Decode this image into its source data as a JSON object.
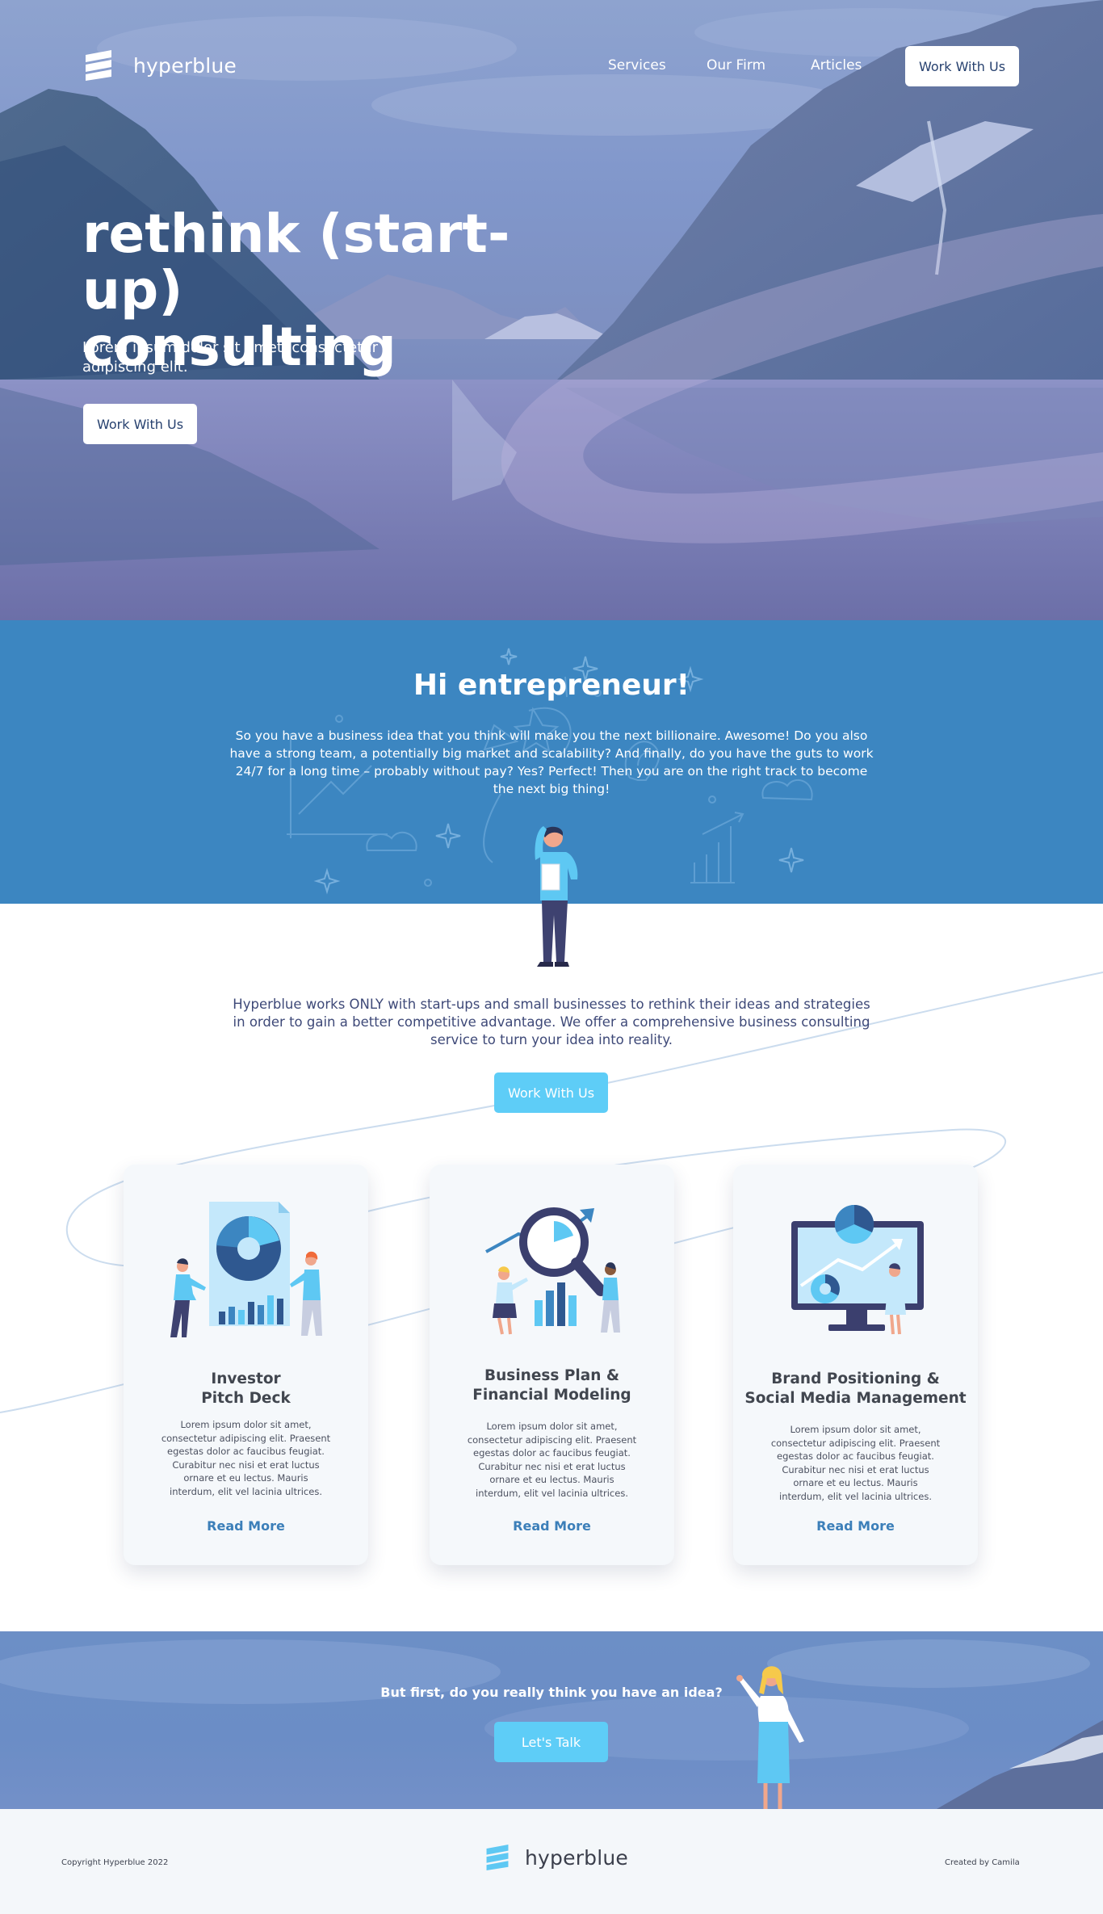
{
  "nav": {
    "brand": "hyperblue",
    "links": [
      "Services",
      "Our Firm",
      "Articles"
    ],
    "cta": "Work With Us"
  },
  "hero": {
    "title_line1": "rethink (start-up)",
    "title_line2": "consulting",
    "subtitle": "Lorem ipsum dolor sit amet, consectetur adipiscing elit.",
    "cta": "Work With Us"
  },
  "intro": {
    "title": "Hi entrepreneur!",
    "text": "So you have a business idea that you think will make you the next billionaire. Awesome! Do you also have a strong team, a potentially big market and scalability? And finally, do you have the guts to work 24/7 for a long time – probably without pay? Yes? Perfect! Then you are on the right track to become the next big thing!"
  },
  "about": {
    "text": "Hyperblue works ONLY with start-ups and small businesses to rethink their ideas and strategies in order to gain a better competitive advantage. We offer a comprehensive business consulting service to turn your idea into reality.",
    "cta": "Work With Us"
  },
  "services": [
    {
      "title_line1": "Investor",
      "title_line2": "Pitch Deck",
      "description": "Lorem ipsum dolor sit amet, consectetur adipiscing elit. Praesent egestas dolor ac faucibus feugiat. Curabitur nec nisi et erat luctus ornare et eu lectus. Mauris interdum, elit vel lacinia ultrices.",
      "link": "Read More"
    },
    {
      "title_line1": "Business Plan &",
      "title_line2": "Financial Modeling",
      "description": "Lorem ipsum dolor sit amet, consectetur adipiscing elit. Praesent egestas dolor ac faucibus feugiat. Curabitur nec nisi et erat luctus ornare et eu lectus. Mauris interdum, elit vel lacinia ultrices.",
      "link": "Read More"
    },
    {
      "title_line1": "Brand Positioning &",
      "title_line2": "Social Media Management",
      "description": "Lorem ipsum dolor sit amet, consectetur adipiscing elit. Praesent egestas dolor ac faucibus feugiat. Curabitur nec nisi et erat luctus ornare et eu lectus. Mauris interdum, elit vel lacinia ultrices.",
      "link": "Read More"
    }
  ],
  "cta_band": {
    "question": "But first, do you really think you have an idea?",
    "button": "Let's Talk"
  },
  "footer": {
    "copyright": "Copyright Hyperblue 2022",
    "brand": "hyperblue",
    "credit": "Created by Camila"
  },
  "colors": {
    "brand_blue": "#3c86c1",
    "accent_cyan": "#5ecdf7",
    "navy_text": "#27416f",
    "link_blue": "#3c7fb9",
    "footer_bg": "#f4f7fa"
  },
  "icons": [
    "hyperblue-logo-icon"
  ]
}
